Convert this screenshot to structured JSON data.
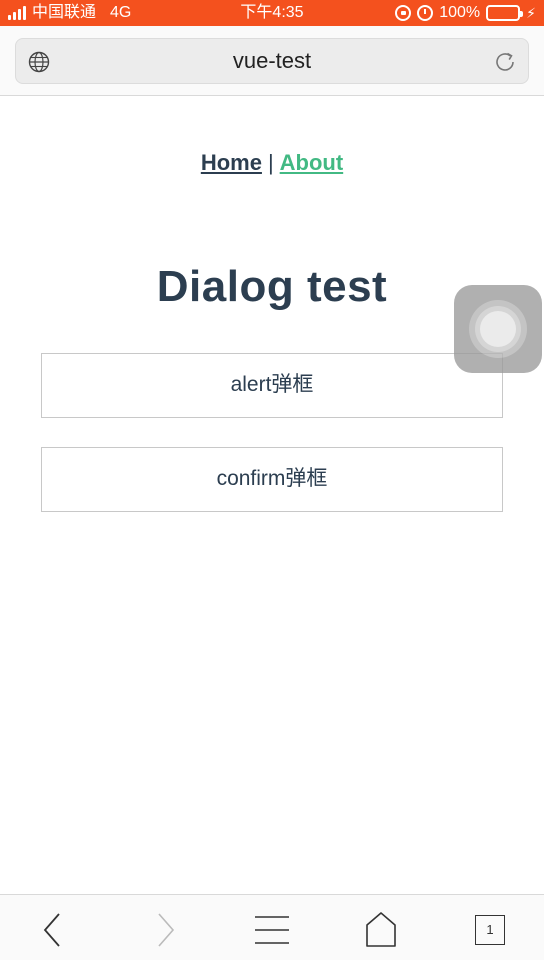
{
  "status_bar": {
    "carrier": "中国联通",
    "network": "4G",
    "time": "下午4:35",
    "battery": "100%",
    "bg_color": "#f4511e"
  },
  "browser": {
    "url_title": "vue-test",
    "left_icon": "globe-icon",
    "right_icon": "reload-icon"
  },
  "nav": {
    "home": "Home",
    "separator": "|",
    "about": "About",
    "home_color": "#2c3e50",
    "about_color": "#42b983"
  },
  "main": {
    "title": "Dialog test",
    "buttons": [
      {
        "label": "alert弹框"
      },
      {
        "label": "confirm弹框"
      }
    ]
  },
  "toolbar": {
    "items": [
      "back-icon",
      "forward-icon",
      "menu-icon",
      "home-icon",
      "tabs-icon"
    ],
    "tab_count": "1"
  }
}
